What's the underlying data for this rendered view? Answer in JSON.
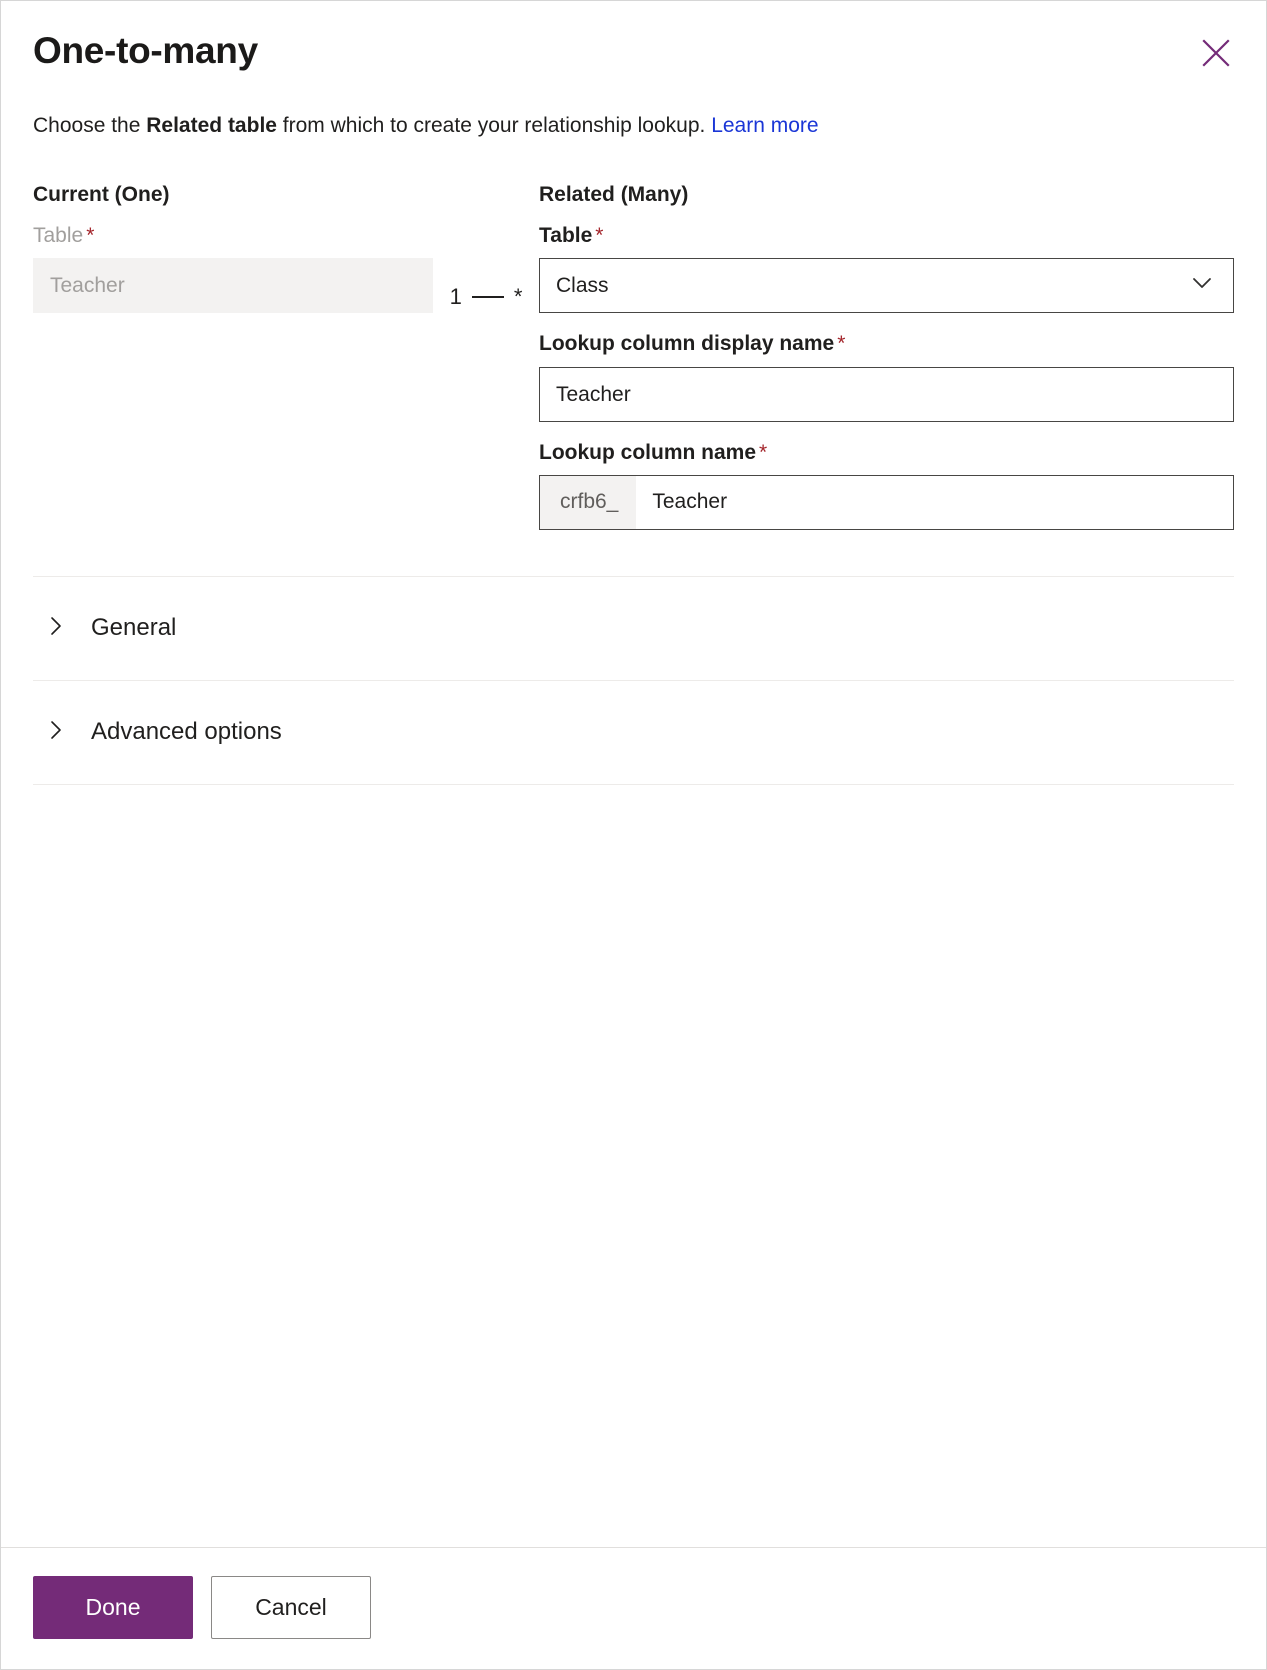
{
  "dialog": {
    "title": "One-to-many",
    "close_icon": "close-icon",
    "description": {
      "prefix": "Choose the ",
      "strong": "Related table",
      "middle": " from which to create your relationship lookup. ",
      "link": "Learn more"
    }
  },
  "current": {
    "heading": "Current (One)",
    "table": {
      "label": "Table",
      "required": "*",
      "value": "Teacher",
      "disabled": true
    }
  },
  "connector": {
    "left": "1",
    "right": "*"
  },
  "related": {
    "heading": "Related (Many)",
    "table": {
      "label": "Table",
      "required": "*",
      "value": "Class",
      "chevron_icon": "chevron-down-icon"
    },
    "display_name": {
      "label": "Lookup column display name",
      "required": "*",
      "value": "Teacher"
    },
    "column_name": {
      "label": "Lookup column name",
      "required": "*",
      "prefix": "crfb6_",
      "value": "Teacher"
    }
  },
  "accordion": [
    {
      "label": "General",
      "icon": "chevron-right-icon",
      "expanded": false
    },
    {
      "label": "Advanced options",
      "icon": "chevron-right-icon",
      "expanded": false
    }
  ],
  "footer": {
    "done_label": "Done",
    "cancel_label": "Cancel"
  },
  "colors": {
    "accent": "#742b78",
    "link": "#1a36d6",
    "required": "#a4262c",
    "disabled_bg": "#f3f2f1"
  }
}
